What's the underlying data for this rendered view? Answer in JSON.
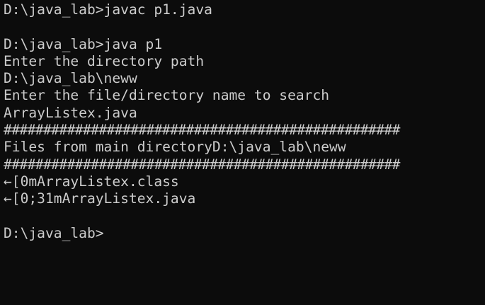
{
  "colors": {
    "background": "#0c0c0c",
    "foreground": "#cccccc"
  },
  "terminal": {
    "lines": [
      "D:\\java_lab>javac p1.java",
      "",
      "D:\\java_lab>java p1",
      "Enter the directory path",
      "D:\\java_lab\\neww",
      "Enter the file/directory name to search",
      "ArrayListex.java",
      "##################################################",
      "Files from main directoryD:\\java_lab\\neww",
      "##################################################",
      "←[0mArrayListex.class",
      "←[0;31mArrayListex.java",
      "",
      "D:\\java_lab>"
    ]
  }
}
